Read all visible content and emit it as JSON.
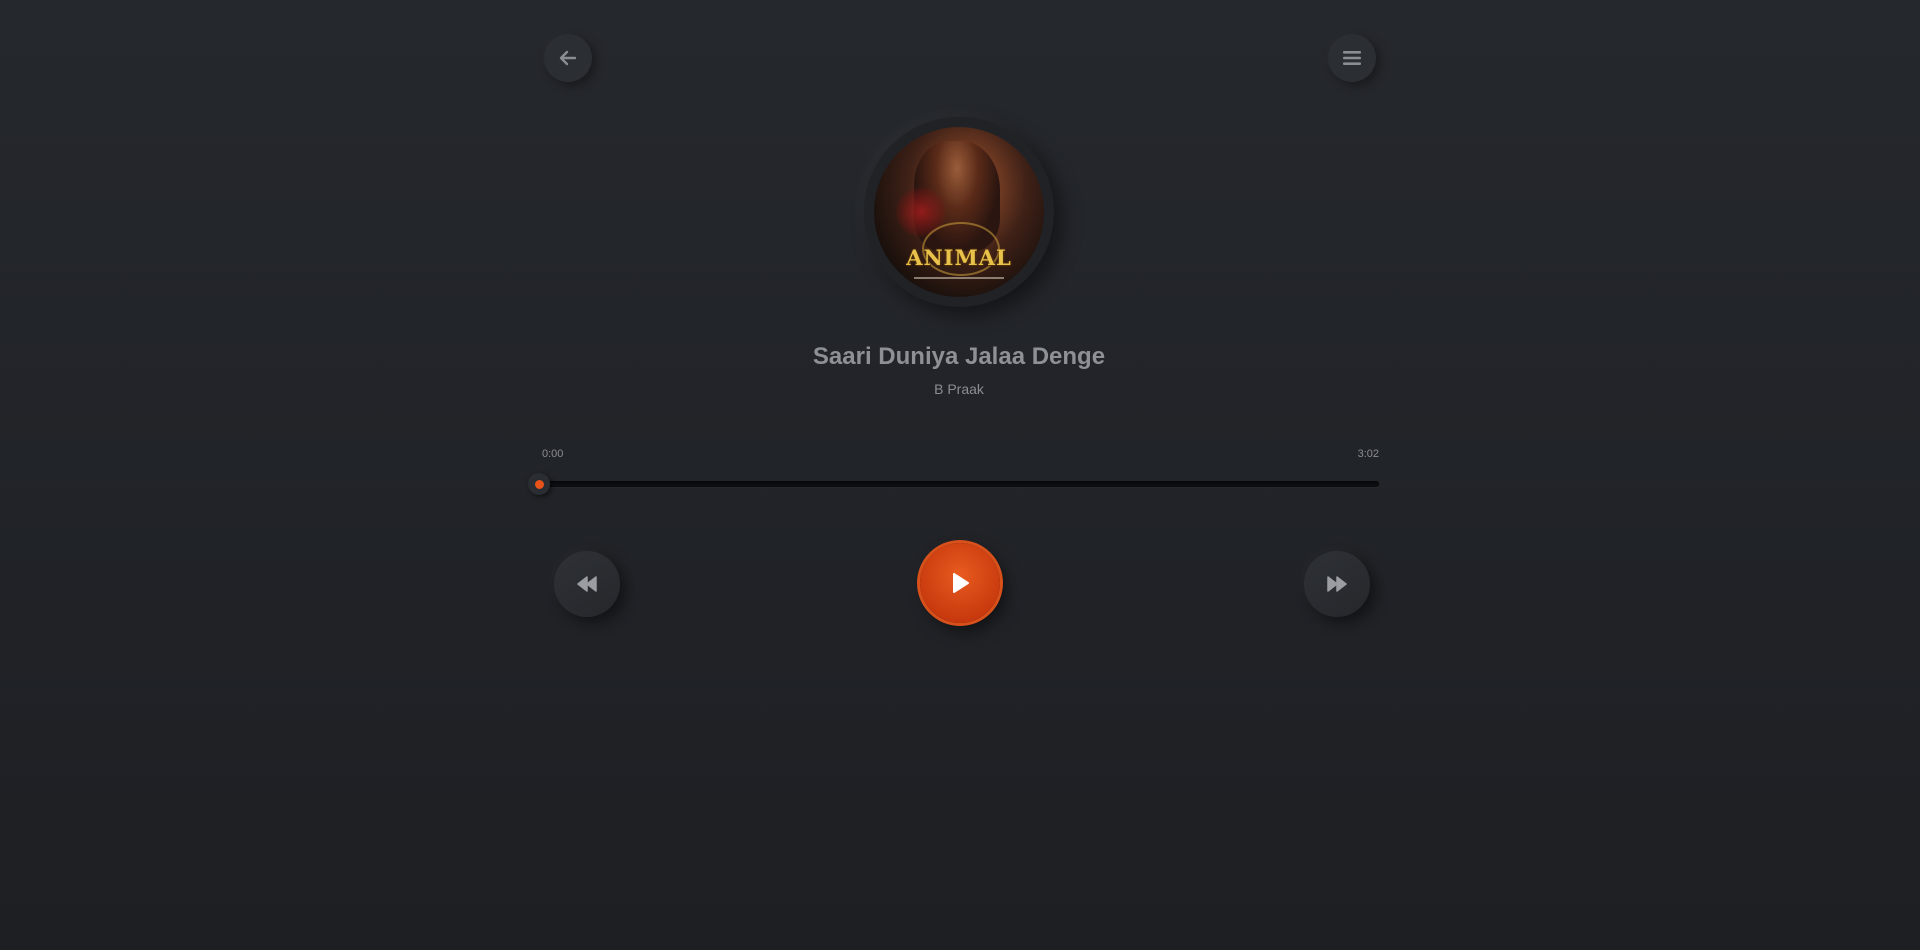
{
  "header": {
    "back_icon": "arrow-left-icon",
    "menu_icon": "hamburger-menu-icon"
  },
  "album": {
    "art_text": "ANIMAL"
  },
  "track": {
    "title": "Saari Duniya Jalaa Denge",
    "artist": "B Praak"
  },
  "progress": {
    "current_time": "0:00",
    "total_time": "3:02",
    "fraction": 0
  },
  "controls": {
    "prev_icon": "rewind-icon",
    "play_icon": "play-icon",
    "next_icon": "fast-forward-icon"
  },
  "colors": {
    "accent": "#e8521b",
    "background": "#22252a",
    "text": "#8a8d92"
  }
}
